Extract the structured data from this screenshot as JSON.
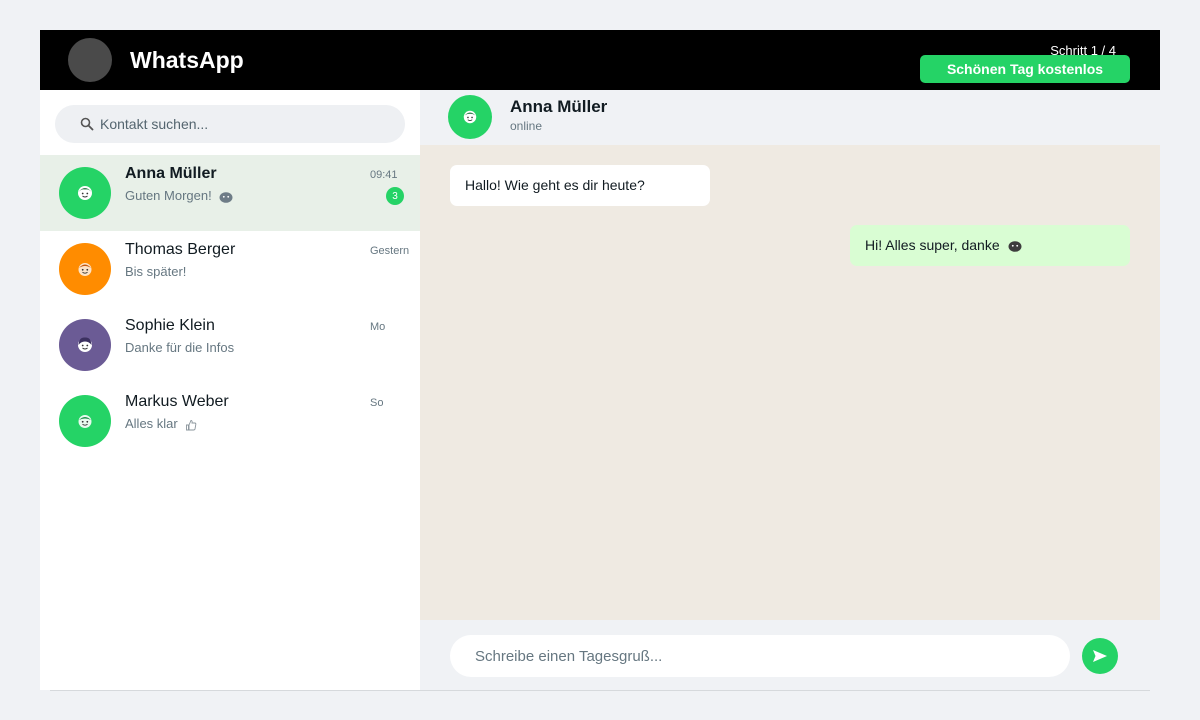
{
  "header": {
    "title": "WhatsApp",
    "step": "Schritt 1 / 4",
    "cta_label": "Schönen Tag kostenlos"
  },
  "search": {
    "placeholder": "Kontakt suchen...",
    "icon": "search-icon"
  },
  "chats": [
    {
      "name": "Anna Müller",
      "preview": "Guten Morgen!",
      "time": "09:41",
      "unread": "3",
      "avatar_color": "#25d366",
      "active": true
    },
    {
      "name": "Thomas Berger",
      "preview": "Bis später!",
      "time": "Gestern",
      "avatar_color": "#ff8c00"
    },
    {
      "name": "Sophie Klein",
      "preview": "Danke für die Infos",
      "time": "Mo",
      "avatar_color": "#6b5b95"
    },
    {
      "name": "Markus Weber",
      "preview": "Alles klar",
      "time": "So",
      "avatar_color": "#25d366"
    }
  ],
  "conversation": {
    "name": "Anna Müller",
    "status": "online",
    "messages": [
      {
        "direction": "incoming",
        "text": "Hallo! Wie geht es dir heute?"
      },
      {
        "direction": "outgoing",
        "text": "Hi! Alles super, danke"
      }
    ]
  },
  "composer": {
    "placeholder": "Schreibe einen Tagesgruß..."
  },
  "colors": {
    "brand_green": "#25d366",
    "header_black": "#000000",
    "chat_background": "#efeae2",
    "outgoing_bubble": "#d9fdd3"
  }
}
